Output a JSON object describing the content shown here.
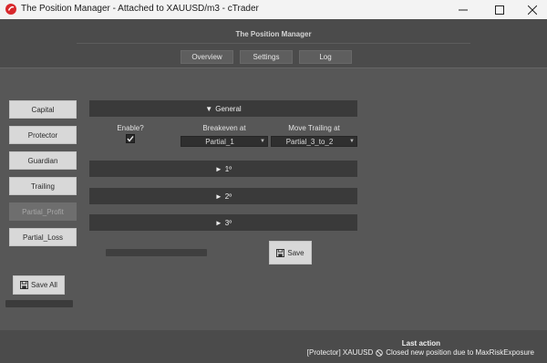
{
  "window": {
    "title": "The Position Manager - Attached to XAUUSD/m3 - cTrader",
    "app_icon": "ctrader-logo-icon",
    "controls": [
      "minimize-icon",
      "maximize-icon",
      "close-icon"
    ]
  },
  "header": {
    "title": "The Position Manager",
    "tabs": [
      {
        "label": "Overview"
      },
      {
        "label": "Settings"
      },
      {
        "label": "Log"
      }
    ]
  },
  "sidebar": {
    "items": [
      {
        "label": "Capital",
        "enabled": true
      },
      {
        "label": "Protector",
        "enabled": true
      },
      {
        "label": "Guardian",
        "enabled": true
      },
      {
        "label": "Trailing",
        "enabled": true
      },
      {
        "label": "Partial_Profit",
        "enabled": false
      },
      {
        "label": "Partial_Loss",
        "enabled": true
      }
    ],
    "save_all_label": "Save All",
    "save_all_icon": "save-disk-icon"
  },
  "general": {
    "header": "General",
    "header_glyph": "▼",
    "enable_label": "Enable?",
    "enable_checked": true,
    "breakeven_label": "Breakeven at",
    "breakeven_value": "Partial_1",
    "trailing_label": "Move Trailing at",
    "trailing_value": "Partial_3_to_2"
  },
  "sections": [
    {
      "label": "1º",
      "glyph": "►"
    },
    {
      "label": "2º",
      "glyph": "►"
    },
    {
      "label": "3º",
      "glyph": "►"
    }
  ],
  "save_label": "Save",
  "status": {
    "heading": "Last action",
    "source": "[Protector] XAUUSD",
    "icon": "blocked-icon",
    "message": "Closed new position due to MaxRiskExposure"
  },
  "colors": {
    "background": "#4b4b4b",
    "panel": "#575757",
    "section_header": "#3a3a3a",
    "button": "#d8d8d8",
    "brand_red": "#d8282c"
  }
}
